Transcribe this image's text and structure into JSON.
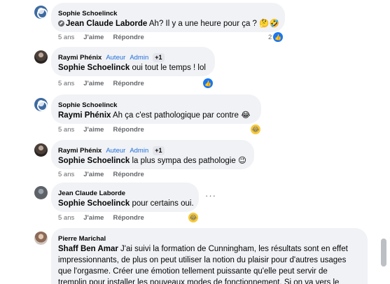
{
  "comments": [
    {
      "author": "Sophie Schoelinck",
      "mention": "Jean Claude Laborde",
      "text": " Ah? Il y a une heure pour ça ? 🤔🤣",
      "time": "5 ans",
      "like": "J'aime",
      "reply": "Répondre",
      "reaction_count": "2",
      "reaction_icons": [
        "like-icon"
      ]
    },
    {
      "author": "Raymi Phénix",
      "badge_author": "Auteur",
      "badge_admin": "Admin",
      "badge_extra": "+1",
      "mention": "Sophie Schoelinck",
      "text": " oui tout le temps ! lol",
      "time": "5 ans",
      "like": "J'aime",
      "reply": "Répondre",
      "reaction_icons": [
        "like-icon"
      ]
    },
    {
      "author": "Sophie Schoelinck",
      "mention": "Raymi Phénix",
      "text": " Ah ça c'est pathologique par contre 😂",
      "time": "5 ans",
      "like": "J'aime",
      "reply": "Répondre",
      "reaction_icons": [
        "haha-icon"
      ]
    },
    {
      "author": "Raymi Phénix",
      "badge_author": "Auteur",
      "badge_admin": "Admin",
      "badge_extra": "+1",
      "mention": "Sophie Schoelinck",
      "text": " la plus sympa des pathologie 😉",
      "time": "5 ans",
      "like": "J'aime",
      "reply": "Répondre"
    },
    {
      "author": "Jean Claude Laborde",
      "mention": "Sophie Schoelinck",
      "text": " pour certains oui.",
      "time": "5 ans",
      "like": "J'aime",
      "reply": "Répondre",
      "more": "···",
      "reaction_icons": [
        "haha-icon"
      ]
    },
    {
      "author": "Pierre Marichal",
      "mention": "Shaff Ben Amar",
      "text_lines": [
        " J'ai suivi la formation de Cunningham, les résultats sont en effet",
        "impressionnants, de plus on peut utiliser la notion du plaisir pour d'autres usages",
        "que l'orgasme. Créer une émotion tellement puissante qu'elle peut servir de",
        "tremplin pour installer les nouveaux modes de fonctionnement. Si on va vers le"
      ]
    }
  ],
  "colors": {
    "bubble": "#f0f2f5",
    "accent": "#1877f2",
    "badge": "#216fdb",
    "meta": "#65676b"
  }
}
